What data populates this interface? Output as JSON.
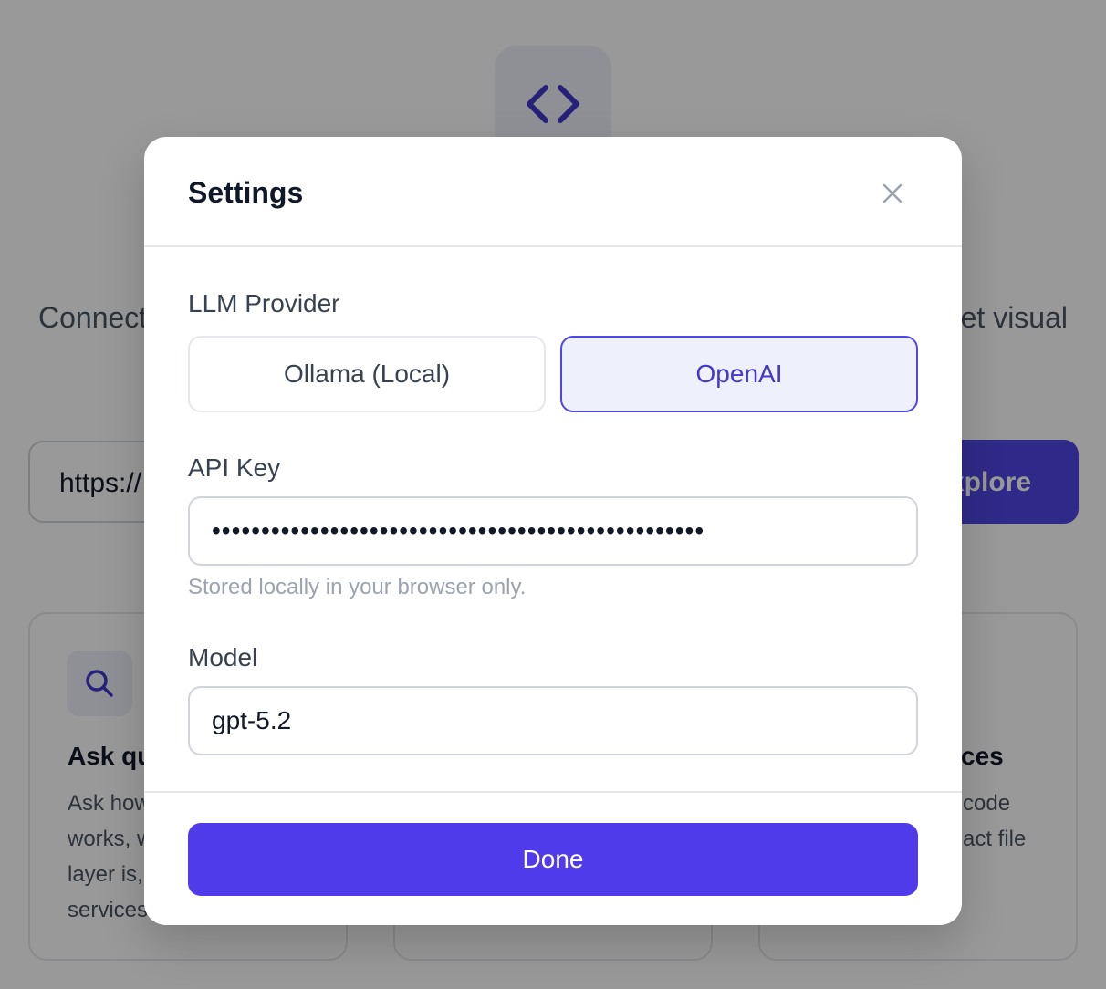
{
  "background": {
    "tagline_left": "Connect",
    "tagline_right": "et visual",
    "url_input_value": "https://",
    "explore_label": "xplore",
    "cards": [
      {
        "title": "Ask qu",
        "body": "Ask how\nworks, w\nlayer is,\nservices"
      },
      {
        "title": "",
        "body": ""
      },
      {
        "title": "ces",
        "body": "code\nact file"
      }
    ]
  },
  "modal": {
    "title": "Settings",
    "provider_label": "LLM Provider",
    "providers": [
      {
        "label": "Ollama (Local)",
        "selected": false
      },
      {
        "label": "OpenAI",
        "selected": true
      }
    ],
    "api_key_label": "API Key",
    "api_key_value": "••••••••••••••••••••••••••••••••••••••••••••••••••",
    "api_key_hint": "Stored locally in your browser only.",
    "model_label": "Model",
    "model_value": "gpt-5.2",
    "done_label": "Done"
  },
  "colors": {
    "accent": "#4f46e5",
    "accent_text": "#4338ca",
    "selected_bg": "#eef0fc",
    "done_bg": "#4f3be9"
  },
  "icons": {
    "logo": "code-brackets-icon",
    "card_1": "search-icon",
    "close": "close-icon"
  }
}
